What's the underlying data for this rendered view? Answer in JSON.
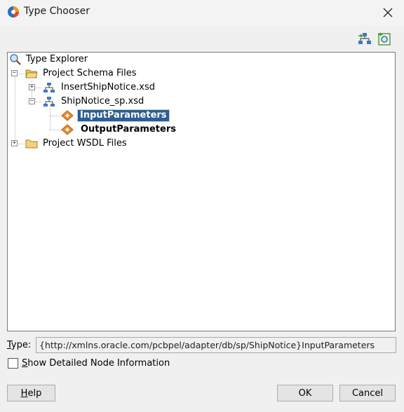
{
  "window": {
    "title": "Type Chooser",
    "icon": "app-swirl-icon",
    "close_icon": "close-icon"
  },
  "toolbar": {
    "buttons": [
      {
        "name": "import-schema-icon"
      },
      {
        "name": "import-wsdl-icon"
      }
    ]
  },
  "tree": {
    "root": {
      "label": "Type Explorer",
      "icon": "magnifier-icon"
    },
    "items": [
      {
        "label": "Project Schema Files",
        "icon": "folder-open-icon",
        "expander": "−"
      },
      {
        "label": "InsertShipNotice.xsd",
        "icon": "schema-icon",
        "expander": "+"
      },
      {
        "label": "ShipNotice_sp.xsd",
        "icon": "schema-icon",
        "expander": "−"
      },
      {
        "label": "InputParameters",
        "icon": "element-icon",
        "selected": true
      },
      {
        "label": "OutputParameters",
        "icon": "element-icon"
      },
      {
        "label": "Project WSDL Files",
        "icon": "folder-icon",
        "expander": "+"
      }
    ]
  },
  "type_field": {
    "label_prefix": "",
    "label_mnemonic": "T",
    "label_rest": "ype:",
    "value": "{http://xmlns.oracle.com/pcbpel/adapter/db/sp/ShipNotice}InputParameters"
  },
  "checkbox": {
    "label_mnemonic": "S",
    "label_rest": "how Detailed Node Information",
    "checked": false
  },
  "buttons": {
    "help_mnemonic": "H",
    "help_rest": "elp",
    "ok": "OK",
    "cancel": "Cancel"
  }
}
